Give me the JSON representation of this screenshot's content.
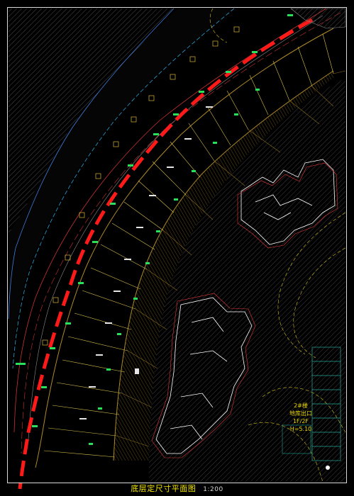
{
  "drawing": {
    "title": "底层定尺寸平面图",
    "scale": "1:200"
  },
  "zone_labels": [
    "2#楼",
    "地库出口",
    "1F/2F",
    "H=5.10"
  ],
  "colors": {
    "background": "#000000",
    "road": "#0a0a0a",
    "curb_blue": "#3d7bd8",
    "red_dash": "#ff1a1a",
    "property_line": "#d63b3b",
    "dim_yellow": "#e8d21a",
    "building_gold": "#b08a2a",
    "hatch_gray": "#5a5a5a",
    "white_building": "#ffffff",
    "label_green": "#28e05a",
    "label_cyan": "#1ed3d3"
  }
}
